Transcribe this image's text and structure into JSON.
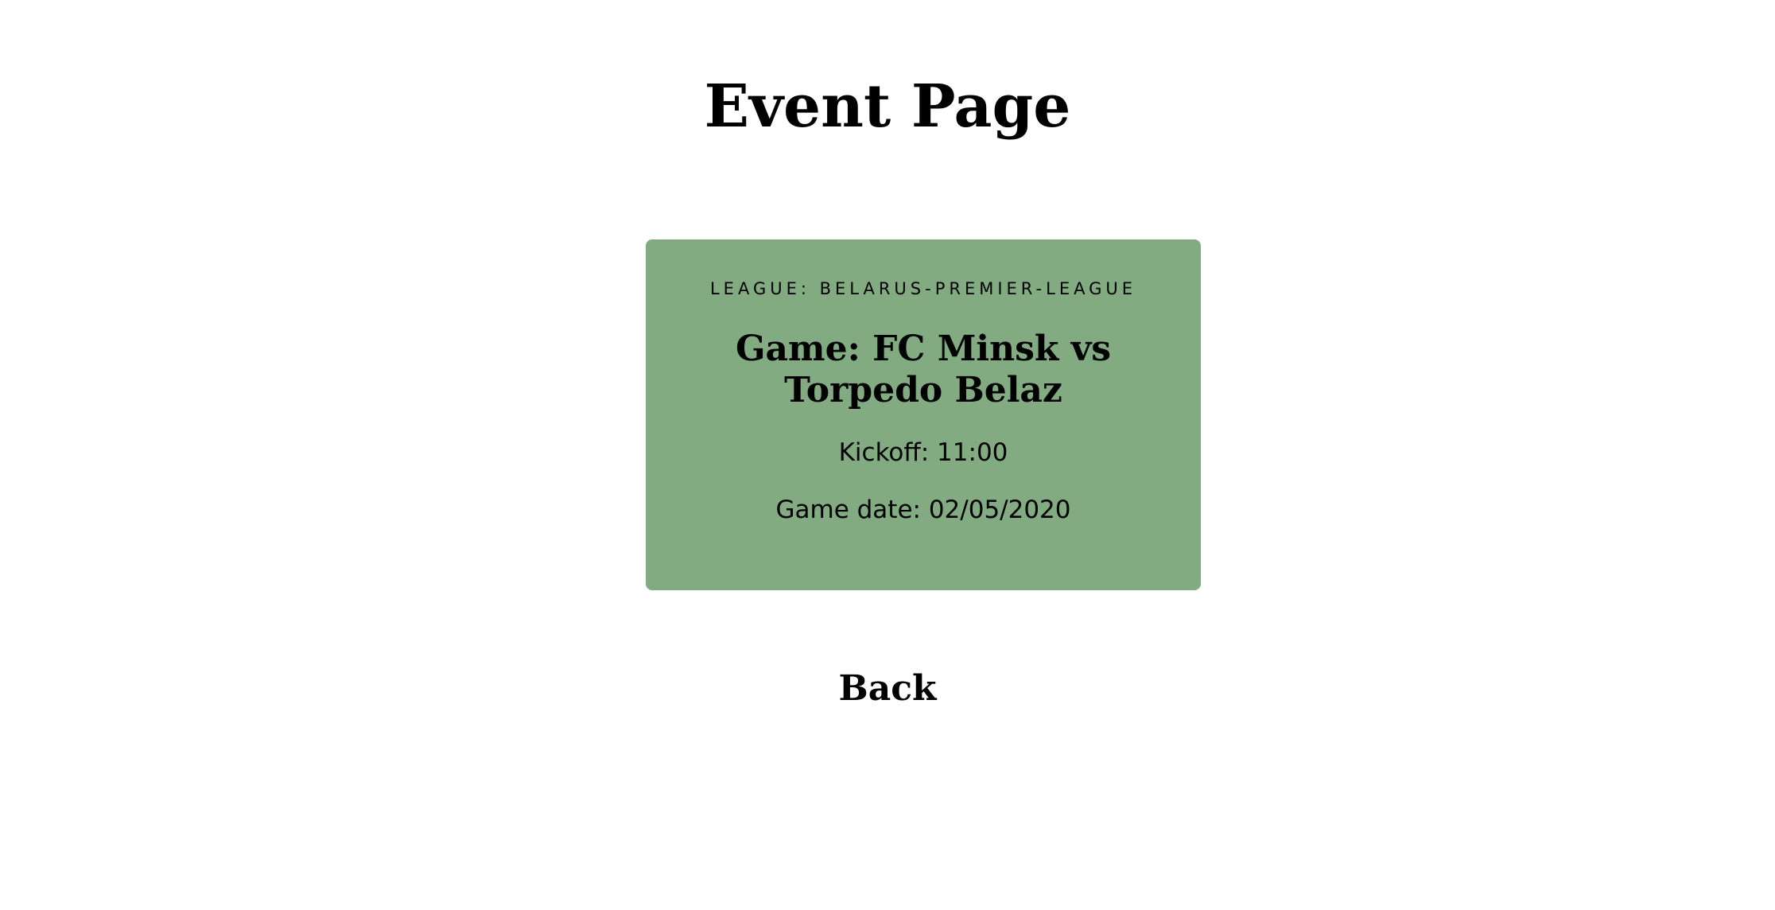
{
  "page": {
    "title": "Event Page"
  },
  "event": {
    "league_text": "LEAGUE: BELARUS-PREMIER-LEAGUE",
    "game_text": "Game: FC Minsk vs Torpedo Belaz",
    "kickoff_text": "Kickoff: 11:00",
    "game_date_text": "Game date: 02/05/2020",
    "card_color": "#82ab82"
  },
  "navigation": {
    "back_label": "Back"
  }
}
